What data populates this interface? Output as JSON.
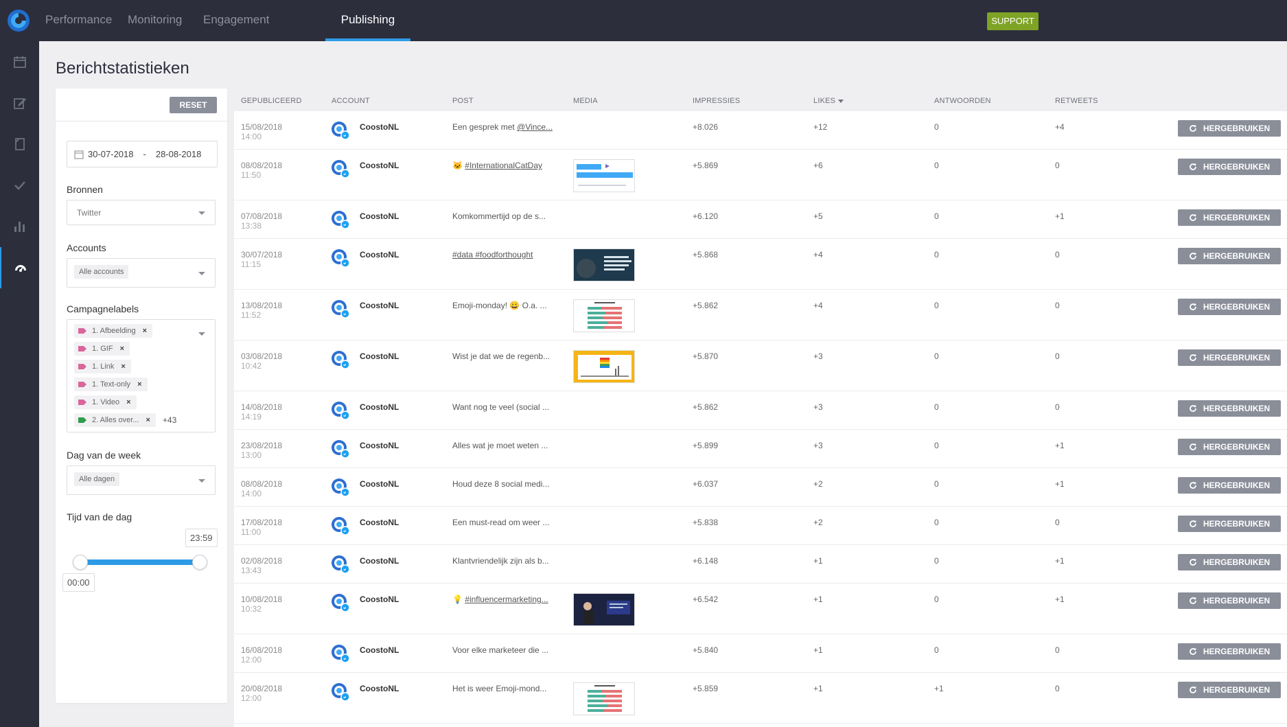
{
  "nav": {
    "tabs": [
      {
        "label": "Performance",
        "active": false
      },
      {
        "label": "Monitoring",
        "active": false
      },
      {
        "label": "Engagement",
        "active": false
      },
      {
        "label": "Publishing",
        "active": true
      }
    ],
    "support_label": "SUPPORT"
  },
  "sidebar": {
    "icons": [
      "calendar-icon",
      "compose-icon",
      "draft-icon",
      "check-icon",
      "bar-chart-icon",
      "dashboard-icon"
    ],
    "active_icon": "dashboard-icon"
  },
  "page": {
    "title": "Berichtstatistieken"
  },
  "filters": {
    "reset_label": "RESET",
    "date_from": "30-07-2018",
    "date_sep": "-",
    "date_to": "28-08-2018",
    "sources_label": "Bronnen",
    "sources_value": "Twitter",
    "accounts_label": "Accounts",
    "accounts_value": "Alle accounts",
    "campaign_label": "Campagnelabels",
    "campaign_tags": [
      {
        "label": "1. Afbeelding",
        "color": "#d9669a"
      },
      {
        "label": "1. GIF",
        "color": "#d9669a"
      },
      {
        "label": "1. Link",
        "color": "#d9669a"
      },
      {
        "label": "1. Text-only",
        "color": "#d9669a"
      },
      {
        "label": "1. Video",
        "color": "#d9669a"
      },
      {
        "label": "2. Alles over...",
        "color": "#2e9e4a"
      }
    ],
    "campaign_more": "+43",
    "weekday_label": "Dag van de week",
    "weekday_value": "Alle dagen",
    "time_label": "Tijd van de dag",
    "time_start": "00:00",
    "time_end": "23:59"
  },
  "table": {
    "columns": [
      "GEPUBLICEERD",
      "ACCOUNT",
      "POST",
      "MEDIA",
      "IMPRESSIES",
      "LIKES",
      "ANTWOORDEN",
      "RETWEETS"
    ],
    "reuse_label": "HERGEBRUIKEN",
    "rows": [
      {
        "date": "15/08/2018",
        "time": "14:00",
        "account": "CoostoNL",
        "post_prefix": "Een gesprek met ",
        "post_tag": "@Vince...",
        "media": "",
        "impressions": "+8.026",
        "likes": "+12",
        "replies": "0",
        "retweets": "+4"
      },
      {
        "date": "08/08/2018",
        "time": "11:50",
        "account": "CoostoNL",
        "post_prefix": "🐱 ",
        "post_tag": "#InternationalCatDay",
        "media": "poll",
        "impressions": "+5.869",
        "likes": "+6",
        "replies": "0",
        "retweets": "0"
      },
      {
        "date": "07/08/2018",
        "time": "13:38",
        "account": "CoostoNL",
        "post_prefix": "Komkommertijd op de s...",
        "post_tag": "",
        "media": "",
        "impressions": "+6.120",
        "likes": "+5",
        "replies": "0",
        "retweets": "+1"
      },
      {
        "date": "30/07/2018",
        "time": "11:15",
        "account": "CoostoNL",
        "post_prefix": "",
        "post_tag": "#data #foodforthought",
        "media": "dark",
        "impressions": "+5.868",
        "likes": "+4",
        "replies": "0",
        "retweets": "0"
      },
      {
        "date": "13/08/2018",
        "time": "11:52",
        "account": "CoostoNL",
        "post_prefix": "Emoji-monday! 😀 O.a. ...",
        "post_tag": "",
        "media": "chart",
        "impressions": "+5.862",
        "likes": "+4",
        "replies": "0",
        "retweets": "0"
      },
      {
        "date": "03/08/2018",
        "time": "10:42",
        "account": "CoostoNL",
        "post_prefix": "Wist je dat we de regenb...",
        "post_tag": "",
        "media": "yellow",
        "impressions": "+5.870",
        "likes": "+3",
        "replies": "0",
        "retweets": "0"
      },
      {
        "date": "14/08/2018",
        "time": "14:19",
        "account": "CoostoNL",
        "post_prefix": "Want nog te veel (social ...",
        "post_tag": "",
        "media": "",
        "impressions": "+5.862",
        "likes": "+3",
        "replies": "0",
        "retweets": "0"
      },
      {
        "date": "23/08/2018",
        "time": "13:00",
        "account": "CoostoNL",
        "post_prefix": "Alles wat je moet weten ...",
        "post_tag": "",
        "media": "",
        "impressions": "+5.899",
        "likes": "+3",
        "replies": "0",
        "retweets": "+1"
      },
      {
        "date": "08/08/2018",
        "time": "14:00",
        "account": "CoostoNL",
        "post_prefix": "Houd deze 8 social medi...",
        "post_tag": "",
        "media": "",
        "impressions": "+6.037",
        "likes": "+2",
        "replies": "0",
        "retweets": "+1"
      },
      {
        "date": "17/08/2018",
        "time": "11:00",
        "account": "CoostoNL",
        "post_prefix": "Een must-read om weer ...",
        "post_tag": "",
        "media": "",
        "impressions": "+5.838",
        "likes": "+2",
        "replies": "0",
        "retweets": "0"
      },
      {
        "date": "02/08/2018",
        "time": "13:43",
        "account": "CoostoNL",
        "post_prefix": "Klantvriendelijk zijn als b...",
        "post_tag": "",
        "media": "",
        "impressions": "+6.148",
        "likes": "+1",
        "replies": "0",
        "retweets": "+1"
      },
      {
        "date": "10/08/2018",
        "time": "10:32",
        "account": "CoostoNL",
        "post_prefix": "💡 ",
        "post_tag": "#influencermarketing...",
        "media": "stage",
        "impressions": "+6.542",
        "likes": "+1",
        "replies": "0",
        "retweets": "+1"
      },
      {
        "date": "16/08/2018",
        "time": "12:00",
        "account": "CoostoNL",
        "post_prefix": "Voor elke marketeer die ...",
        "post_tag": "",
        "media": "",
        "impressions": "+5.840",
        "likes": "+1",
        "replies": "0",
        "retweets": "0"
      },
      {
        "date": "20/08/2018",
        "time": "12:00",
        "account": "CoostoNL",
        "post_prefix": "Het is weer Emoji-mond...",
        "post_tag": "",
        "media": "chart",
        "impressions": "+5.859",
        "likes": "+1",
        "replies": "+1",
        "retweets": "0"
      }
    ]
  },
  "colors": {
    "nav_bg": "#2c2e3c",
    "accent": "#2d9be6",
    "support": "#7ea325",
    "button_grey": "#8a8e99"
  }
}
